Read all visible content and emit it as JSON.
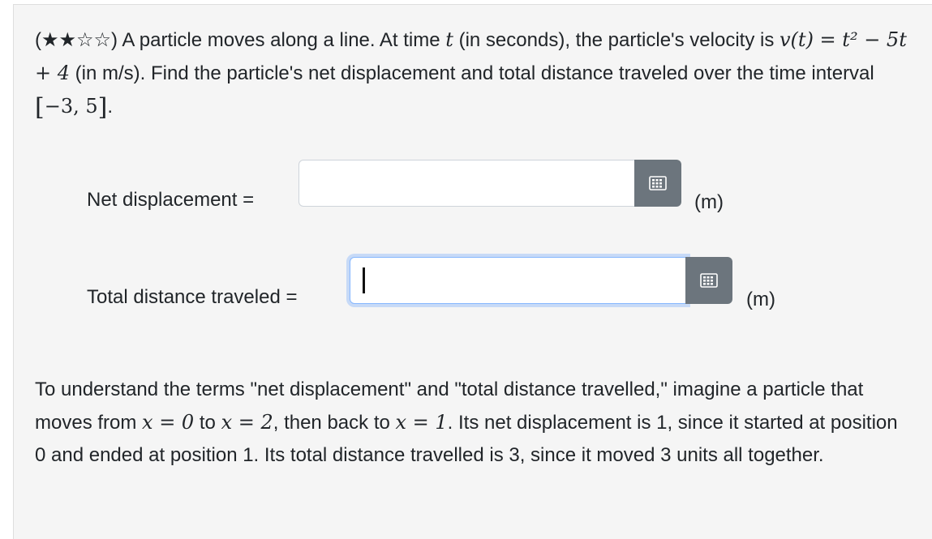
{
  "question": {
    "stars": "(★★☆☆)",
    "p1": " A particle moves along a line. At time ",
    "t": "t",
    "p2": " (in seconds), the particle's velocity is ",
    "velocity_expr": "v(t) = t² − 5t + 4",
    "p3": " (in m/s). Find the particle's net displacement and total distance traveled over the time interval ",
    "interval": "−3, 5",
    "p4": "."
  },
  "net_displacement": {
    "label": "Net displacement =",
    "value": "",
    "unit": "(m)"
  },
  "total_distance": {
    "label": "Total distance traveled =",
    "value": "",
    "unit": "(m)"
  },
  "hint": {
    "p1": "To understand the terms \"net displacement\" and \"total distance travelled,\" imagine a particle that moves from ",
    "m1": "x = 0",
    "p2": " to ",
    "m2": "x = 2",
    "p3": ", then back to ",
    "m3": "x = 1",
    "p4": ". Its net displacement is 1, since it started at position 0 and ended at position 1. Its total distance travelled is 3, since it moved 3 units all together."
  },
  "icons": {
    "keyboard": "keyboard-icon"
  }
}
